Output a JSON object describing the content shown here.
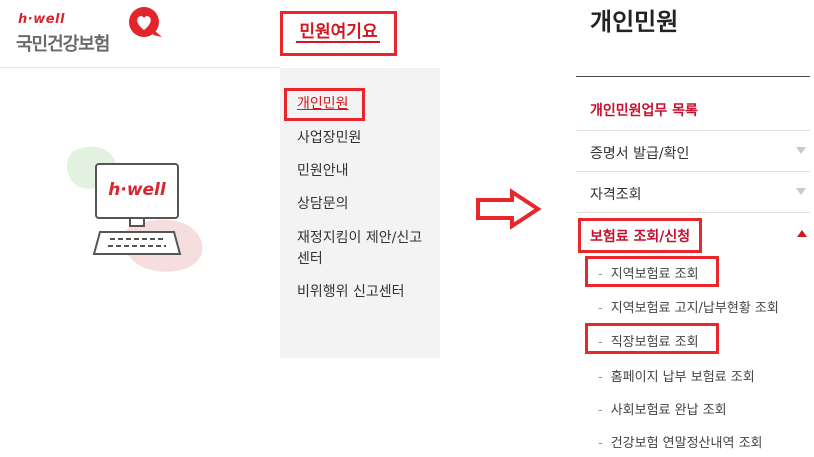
{
  "logo": {
    "brand": "h·well",
    "org": "국민건강보험"
  },
  "illustration": {
    "screen_text": "h·well"
  },
  "menu": {
    "title": "민원여기요",
    "items": [
      {
        "label": "개인민원"
      },
      {
        "label": "사업장민원"
      },
      {
        "label": "민원안내"
      },
      {
        "label": "상담문의"
      },
      {
        "label": "재정지킴이 제안/신고"
      },
      {
        "label": "센터"
      },
      {
        "label": "비위행위 신고센터"
      }
    ]
  },
  "detail": {
    "title": "개인민원",
    "section_label": "개인민원업무 목록",
    "rows": [
      {
        "label": "증명서 발급/확인"
      },
      {
        "label": "자격조회"
      },
      {
        "label": "보험료 조회/신청"
      }
    ],
    "sub_items": [
      {
        "label": "지역보험료 조회"
      },
      {
        "label": "지역보험료 고지/납부현황 조회"
      },
      {
        "label": "직장보험료 조회"
      },
      {
        "label": "홈페이지 납부 보험료 조회"
      },
      {
        "label": "사회보험료 완납 조회"
      },
      {
        "label": "건강보험 연말정산내역 조회"
      }
    ]
  },
  "colors": {
    "accent": "#d4161d",
    "highlight_box": "#e8262b",
    "panel_bg": "#f3f3f3"
  },
  "icons": {
    "logo_mark": "heart-icon",
    "transition": "arrow-right-icon",
    "collapsed": "triangle-down-icon",
    "expanded": "triangle-up-icon"
  }
}
